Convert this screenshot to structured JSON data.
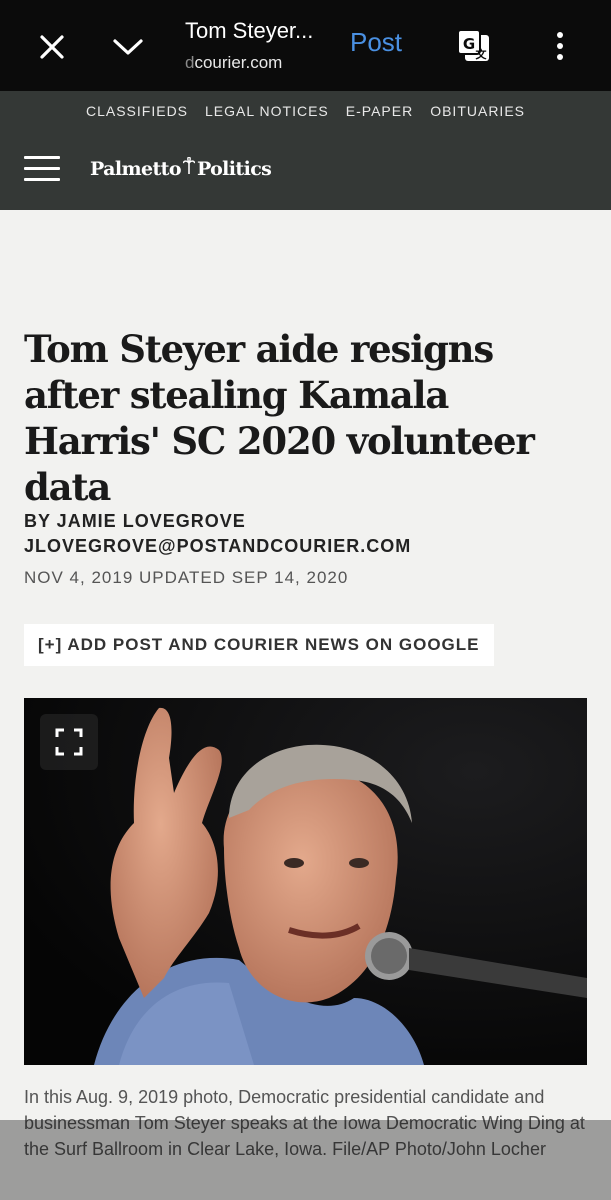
{
  "browser": {
    "title": "Tom Steyer...",
    "url_faded": "d",
    "url": "courier.com",
    "post_label": "Post",
    "icons": {
      "close": "close-icon",
      "collapse": "chevron-down-icon",
      "translate": "translate-icon",
      "more": "more-vert-icon"
    },
    "accent_color": "#4a90e2"
  },
  "site": {
    "nav": [
      "CLASSIFIEDS",
      "LEGAL NOTICES",
      "E-PAPER",
      "OBITUARIES"
    ],
    "logo_left": "Palmetto",
    "logo_right": "Politics",
    "header_color": "#343836"
  },
  "article": {
    "headline": "Tom Steyer aide resigns after stealing Kamala Harris' SC 2020 volunteer data",
    "byline_name": "BY JAMIE LOVEGROVE",
    "byline_email": "JLOVEGROVE@POSTANDCOURIER.COM",
    "date": "NOV 4, 2019 UPDATED SEP 14, 2020",
    "google_button": "[+] ADD POST AND COURIER NEWS ON GOOGLE",
    "photo_caption": "In this Aug. 9, 2019 photo, Democratic presidential candidate and businessman Tom Steyer speaks at the Iowa Democratic Wing Ding at the Surf Ballroom in Clear Lake, Iowa. File/AP Photo/John Locher"
  }
}
